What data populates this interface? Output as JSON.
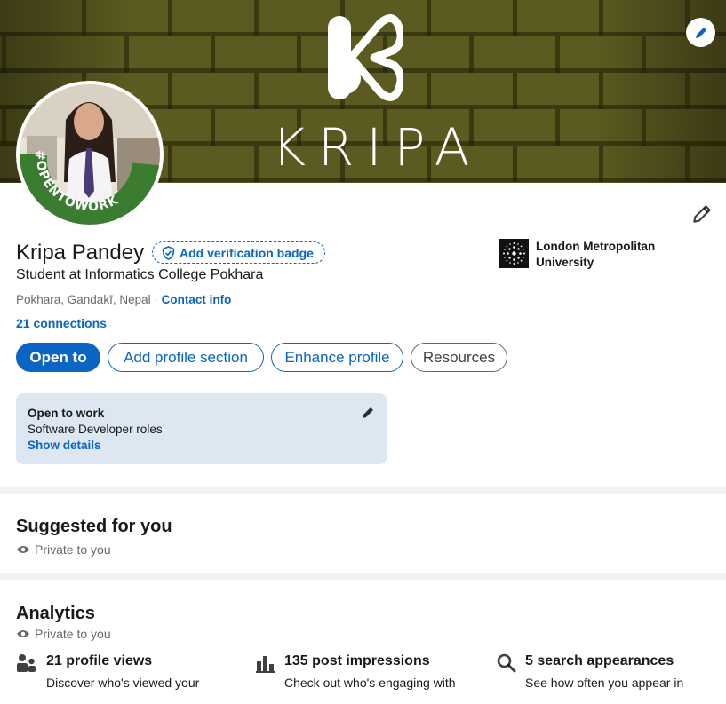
{
  "banner": {
    "brand_text": "KRIPA",
    "logo_icon": "kripa-k-logo"
  },
  "avatar": {
    "ring_text": "#OPENTOWORK"
  },
  "profile": {
    "name": "Kripa Pandey",
    "verification_label": "Add verification badge",
    "headline": "Student at Informatics College Pokhara",
    "location": "Pokhara, Gandakī, Nepal",
    "separator": " · ",
    "contact_label": "Contact info",
    "connections": "21 connections"
  },
  "education": {
    "school": "London Metropolitan University"
  },
  "actions": {
    "open_to": "Open to",
    "add_section": "Add profile section",
    "enhance": "Enhance profile",
    "resources": "Resources"
  },
  "open_to_work": {
    "title": "Open to work",
    "roles": "Software Developer roles",
    "details_link": "Show details"
  },
  "suggested": {
    "title": "Suggested for you",
    "privacy": "Private to you"
  },
  "analytics": {
    "title": "Analytics",
    "privacy": "Private to you",
    "metrics": [
      {
        "icon": "people-icon",
        "title": "21 profile views",
        "subtitle": "Discover who's viewed your"
      },
      {
        "icon": "bar-chart-icon",
        "title": "135 post impressions",
        "subtitle": "Check out who's engaging with"
      },
      {
        "icon": "search-icon",
        "title": "5 search appearances",
        "subtitle": "See how often you appear in"
      }
    ]
  },
  "colors": {
    "brand_blue": "#0a66c2",
    "banner_olive": "#5b5a20",
    "otw_green": "#3a7d31"
  }
}
